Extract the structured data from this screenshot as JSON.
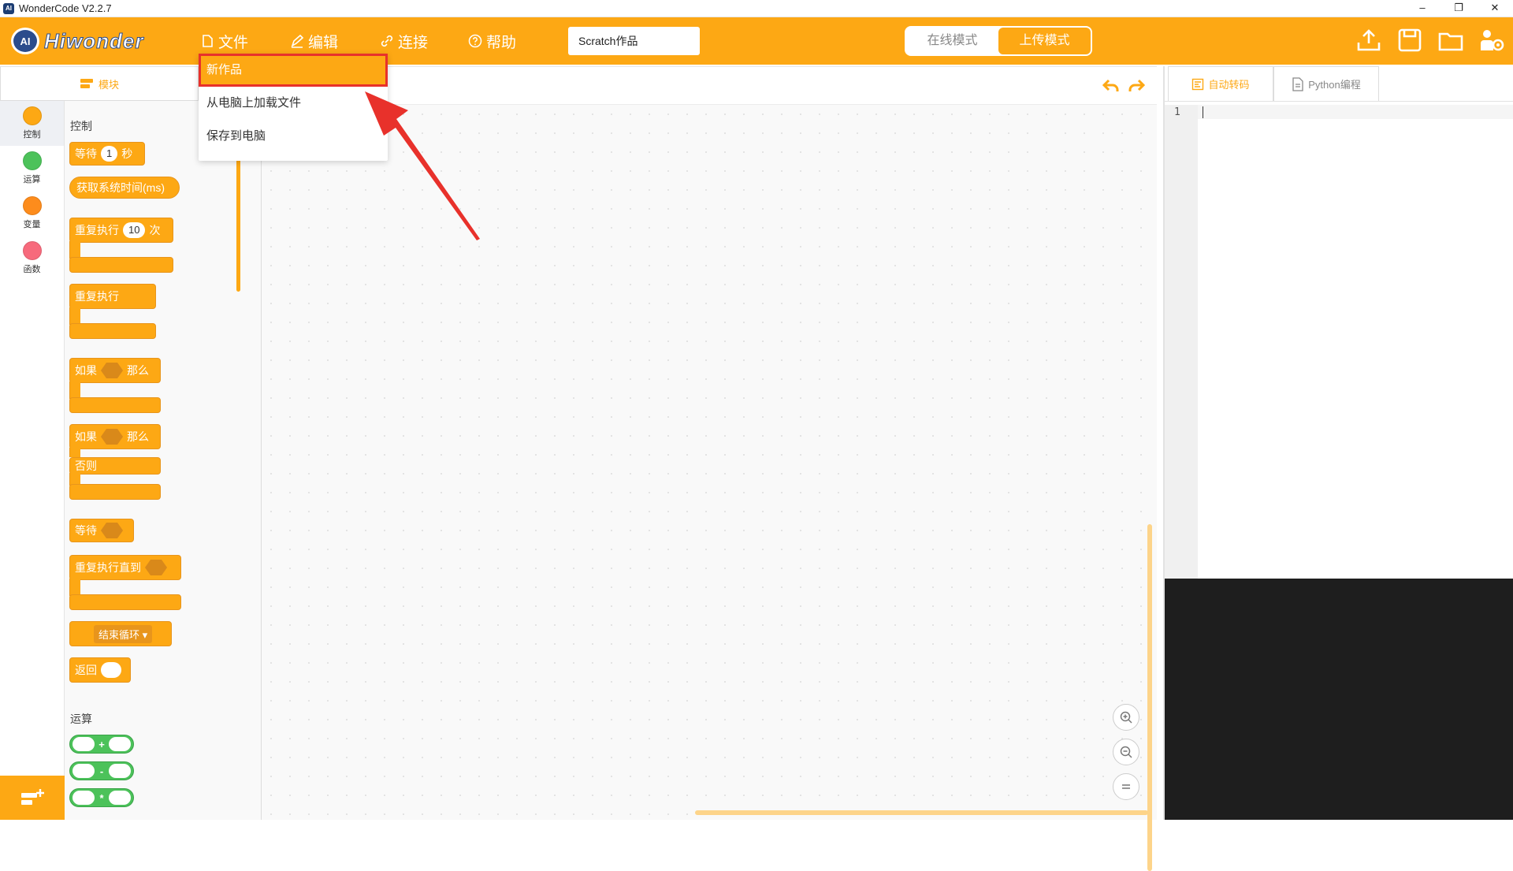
{
  "window": {
    "title": "WonderCode V2.2.7",
    "app_icon_text": "AI"
  },
  "logo": {
    "badge": "AI",
    "brand": "Hiwonder"
  },
  "menu": {
    "file": "文件",
    "edit": "编辑",
    "connect": "连接",
    "help": "帮助"
  },
  "project": {
    "name": "Scratch作品"
  },
  "modes": {
    "online": "在线模式",
    "upload": "上传模式",
    "active": "upload"
  },
  "panel_tab": {
    "label": "模块"
  },
  "categories": [
    {
      "label": "控制",
      "color": "#fda814"
    },
    {
      "label": "运算",
      "color": "#4cc25a"
    },
    {
      "label": "变量",
      "color": "#fd8c1c"
    },
    {
      "label": "函数",
      "color": "#f76a7c"
    }
  ],
  "palette": {
    "control_title": "控制",
    "operators_title": "运算",
    "wait": "等待",
    "wait_value": "1",
    "wait_unit": "秒",
    "get_time": "获取系统时间(ms)",
    "repeat": "重复执行",
    "repeat_value": "10",
    "repeat_unit": "次",
    "forever": "重复执行",
    "if": "如果",
    "then": "那么",
    "if2": "如果",
    "then2": "那么",
    "else": "否则",
    "wait_until": "等待",
    "repeat_until": "重复执行直到",
    "break_loop": "结束循环 ▾",
    "return": "返回",
    "ops": [
      "+",
      "-",
      "*"
    ]
  },
  "code_tabs": {
    "auto": "自动转码",
    "python": "Python编程"
  },
  "editor": {
    "line1": "1"
  },
  "file_menu": {
    "items": [
      "新作品",
      "从电脑上加载文件",
      "保存到电脑"
    ],
    "highlighted": 0
  },
  "colors": {
    "accent": "#fda814",
    "annotation": "#e8312b"
  }
}
